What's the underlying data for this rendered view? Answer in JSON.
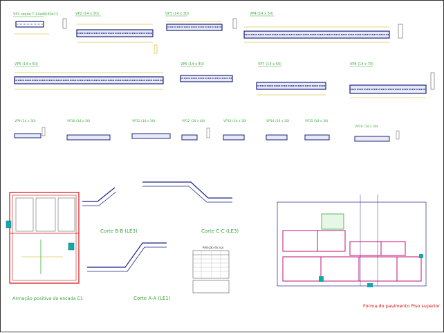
{
  "beams_row1": [
    {
      "title": "VP1 seção T 14x40/30x12"
    },
    {
      "title": "VP2 (14 x 50)"
    },
    {
      "title": "VP3 (14 x 30)"
    },
    {
      "title": "VP4 (14 x 50)"
    }
  ],
  "beams_row2": [
    {
      "title": "VP5 (14 x 50)"
    },
    {
      "title": "VP6 (14 x 40)"
    },
    {
      "title": "VP7 (14 x 50)"
    },
    {
      "title": "VP8 (14 x 70)"
    }
  ],
  "beams_row3": [
    {
      "title": "VP9 (14 x 30)"
    },
    {
      "title": "VP10 (14 x 30)"
    },
    {
      "title": "VP11 (14 x 30)"
    },
    {
      "title": "VP12 (14 x 40)"
    },
    {
      "title": "VP13 (14 x 30)"
    },
    {
      "title": "VP14 (14 x 30)"
    },
    {
      "title": "VP15 (14 x 30)"
    },
    {
      "title": "VP16 (14 x 30)"
    }
  ],
  "sections": {
    "corte_bb": "Corte B-B (LE3)",
    "corte_cc": "Corte C-C (LE3)",
    "corte_aa": "Corte A-A (LE1)"
  },
  "stair_plan_caption": "Armação positiva da escada E1",
  "floor_plan_caption": "Forma do pavimento Piso superior",
  "table_title": "Relação do aço",
  "colors": {
    "beam": "#1a237e",
    "green_text": "#3aa63a",
    "yellow_dim": "#c8b400",
    "red": "#d01010",
    "magenta": "#c0107a",
    "cyan": "#11aaaa",
    "blue_text": "#3a4ab0",
    "grid": "#000080"
  }
}
